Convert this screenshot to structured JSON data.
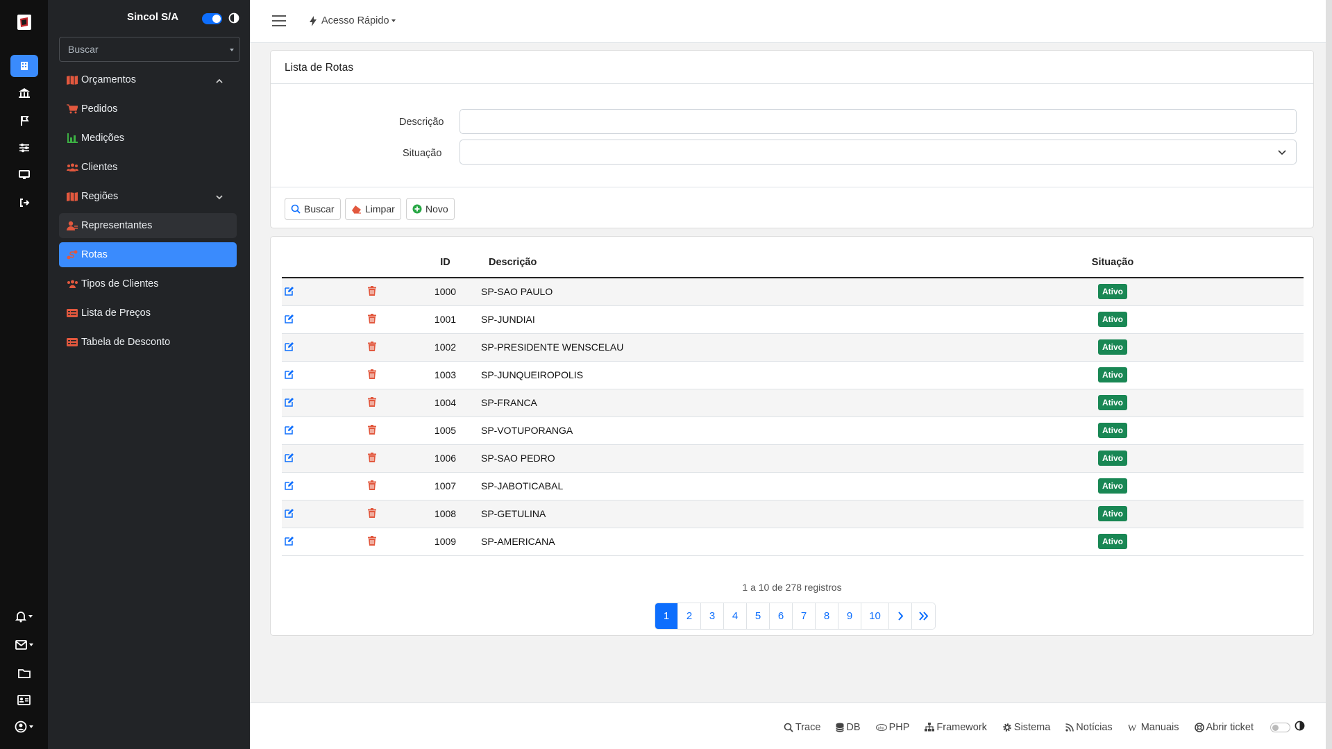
{
  "rail": {
    "top_icons": [
      "building-icon",
      "bank-icon",
      "flag-icon",
      "sliders-icon",
      "monitor-icon",
      "logout-icon"
    ],
    "bottom_icons": [
      "bell-icon",
      "mail-icon",
      "folder-icon",
      "id-card-icon",
      "user-circle-icon"
    ]
  },
  "sidebar": {
    "company": "Sincol S/A",
    "search_placeholder": "Buscar",
    "items": [
      {
        "label": "Orçamentos",
        "icon": "map-icon"
      },
      {
        "label": "Pedidos",
        "icon": "cart-icon"
      },
      {
        "label": "Medições",
        "icon": "bar-chart-icon"
      },
      {
        "label": "Clientes",
        "icon": "users-icon"
      },
      {
        "label": "Regiões",
        "icon": "map-icon"
      },
      {
        "label": "Representantes",
        "icon": "user-tie-icon"
      },
      {
        "label": "Rotas",
        "icon": "route-icon"
      },
      {
        "label": "Tipos de Clientes",
        "icon": "users-icon"
      },
      {
        "label": "Lista de Preços",
        "icon": "list-icon"
      },
      {
        "label": "Tabela de Desconto",
        "icon": "list-icon"
      }
    ]
  },
  "topbar": {
    "quick_access": "Acesso Rápido"
  },
  "filter": {
    "title": "Lista de Rotas",
    "descricao_label": "Descrição",
    "situacao_label": "Situação",
    "buttons": {
      "buscar": "Buscar",
      "limpar": "Limpar",
      "novo": "Novo"
    }
  },
  "table": {
    "headers": {
      "id": "ID",
      "descricao": "Descrição",
      "situacao": "Situação"
    },
    "rows": [
      {
        "id": "1000",
        "descricao": "SP-SAO PAULO",
        "situacao": "Ativo"
      },
      {
        "id": "1001",
        "descricao": "SP-JUNDIAI",
        "situacao": "Ativo"
      },
      {
        "id": "1002",
        "descricao": "SP-PRESIDENTE WENSCELAU",
        "situacao": "Ativo"
      },
      {
        "id": "1003",
        "descricao": "SP-JUNQUEIROPOLIS",
        "situacao": "Ativo"
      },
      {
        "id": "1004",
        "descricao": "SP-FRANCA",
        "situacao": "Ativo"
      },
      {
        "id": "1005",
        "descricao": "SP-VOTUPORANGA",
        "situacao": "Ativo"
      },
      {
        "id": "1006",
        "descricao": "SP-SAO PEDRO",
        "situacao": "Ativo"
      },
      {
        "id": "1007",
        "descricao": "SP-JABOTICABAL",
        "situacao": "Ativo"
      },
      {
        "id": "1008",
        "descricao": "SP-GETULINA",
        "situacao": "Ativo"
      },
      {
        "id": "1009",
        "descricao": "SP-AMERICANA",
        "situacao": "Ativo"
      }
    ],
    "summary": "1 a 10 de 278 registros",
    "pages": [
      "1",
      "2",
      "3",
      "4",
      "5",
      "6",
      "7",
      "8",
      "9",
      "10"
    ],
    "current_page": "1"
  },
  "footer": {
    "links": [
      {
        "label": "Trace",
        "icon": "search-icon"
      },
      {
        "label": "DB",
        "icon": "database-icon"
      },
      {
        "label": "PHP",
        "icon": "php-icon"
      },
      {
        "label": "Framework",
        "icon": "sitemap-icon"
      },
      {
        "label": "Sistema",
        "icon": "cog-icon"
      },
      {
        "label": "Notícias",
        "icon": "rss-icon"
      },
      {
        "label": "Manuais",
        "icon": "wikipedia-icon"
      },
      {
        "label": "Abrir ticket",
        "icon": "lifebuoy-icon"
      }
    ]
  },
  "colors": {
    "accent": "#3a8bfd",
    "primary": "#0d6efd",
    "danger_icon": "#e2583e",
    "success": "#198754",
    "sidebar_bg": "#222427",
    "rail_bg": "#101010"
  }
}
